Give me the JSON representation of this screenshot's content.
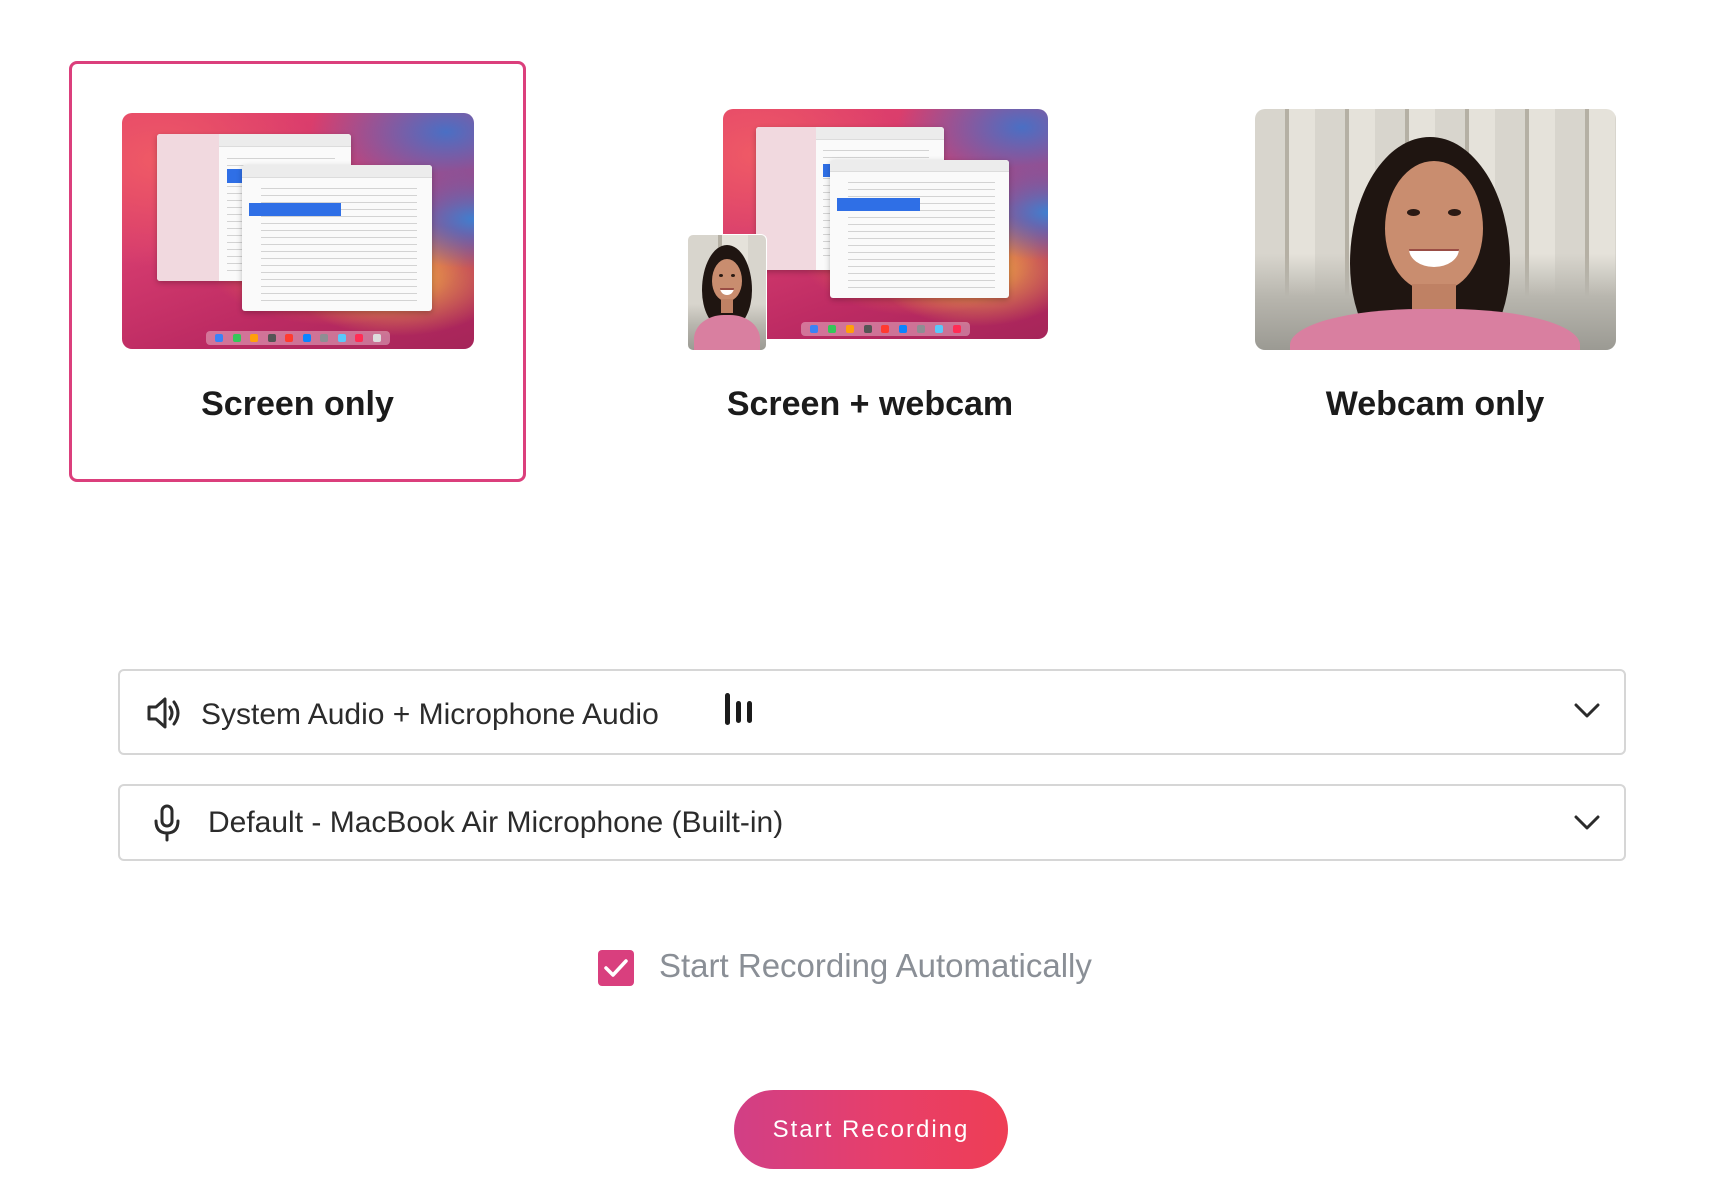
{
  "modes": [
    {
      "id": "screen",
      "label": "Screen only",
      "selected": true
    },
    {
      "id": "screen-webcam",
      "label": "Screen + webcam",
      "selected": false
    },
    {
      "id": "webcam",
      "label": "Webcam only",
      "selected": false
    }
  ],
  "audio_select": {
    "value": "System Audio + Microphone Audio",
    "icon": "speaker-icon",
    "indicator_icon": "audio-level-icon"
  },
  "mic_select": {
    "value": "Default - MacBook Air Microphone (Built-in)",
    "icon": "microphone-icon"
  },
  "auto_start": {
    "label": "Start Recording Automatically",
    "checked": true
  },
  "start_button": {
    "label": "Start Recording"
  },
  "colors": {
    "accent": "#db3f7c",
    "button_gradient_start": "#d13f86",
    "button_gradient_end": "#ee3e55",
    "muted_text": "#8a8f96"
  }
}
